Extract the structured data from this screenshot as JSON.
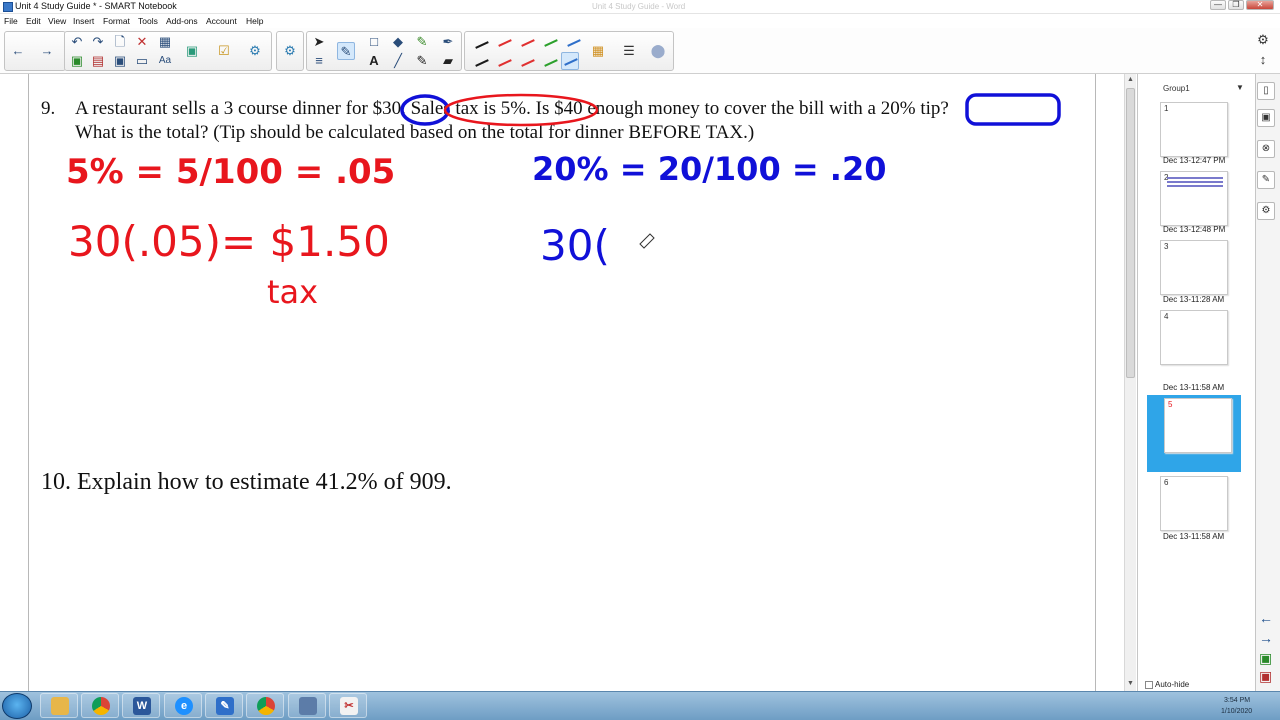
{
  "window": {
    "title": "Unit 4 Study Guide * - SMART Notebook",
    "ghost_title": "Unit 4 Study Guide - Word",
    "controls": [
      "—",
      "❐",
      "✕"
    ]
  },
  "menu": [
    "File",
    "Edit",
    "View",
    "Insert",
    "Format",
    "Tools",
    "Add-ons",
    "Account",
    "Help"
  ],
  "toolbar": {
    "back_icon": "arrow-left",
    "forward_icon": "arrow-right",
    "pen_colors": [
      "#1a1a1a",
      "#e03030",
      "#e03030",
      "#2ca02c",
      "#2f6fc9",
      "#1a1a1a",
      "#e03030",
      "#e03030",
      "#2ca02c",
      "#2f6fc9"
    ]
  },
  "document": {
    "q9": {
      "number": "9.",
      "line1": "A restaurant sells a 3 course dinner for $30. Sales tax is 5%. Is $40 enough money to cover the bill with a 20% tip?",
      "line2": "What is the total? (Tip should be calculated based on the total for dinner BEFORE TAX.)"
    },
    "q10": "10. Explain how to estimate 41.2% of 909.",
    "ink": {
      "red_percent": "5% = 5/100 = .05",
      "red_tax_calc": "30(.05)= $1.50",
      "red_tax_word": "tax",
      "blue_percent": "20% = 20/100 = .20",
      "blue_tip_calc": "30("
    },
    "ink_colors": {
      "red": "#e8161d",
      "blue": "#1010d8"
    }
  },
  "sorter": {
    "group": "Group1",
    "pages": [
      {
        "num": "1",
        "time": "Dec 13-12:47 PM"
      },
      {
        "num": "2",
        "time": "Dec 13-12:48 PM"
      },
      {
        "num": "3",
        "time": "Dec 13-11:28 AM"
      },
      {
        "num": "4",
        "time": "Dec 13-11:58 AM"
      },
      {
        "num": "5",
        "time": ""
      },
      {
        "num": "6",
        "time": "Dec 13-11:58 AM"
      }
    ],
    "selected_page": "5",
    "autohide": "Auto-hide"
  },
  "taskbar": {
    "apps": [
      "file-explorer",
      "chrome",
      "word",
      "internet-explorer",
      "smart-notebook",
      "chrome",
      "app",
      "snipping-tool"
    ],
    "time": "3:54 PM",
    "date": "1/10/2020"
  }
}
